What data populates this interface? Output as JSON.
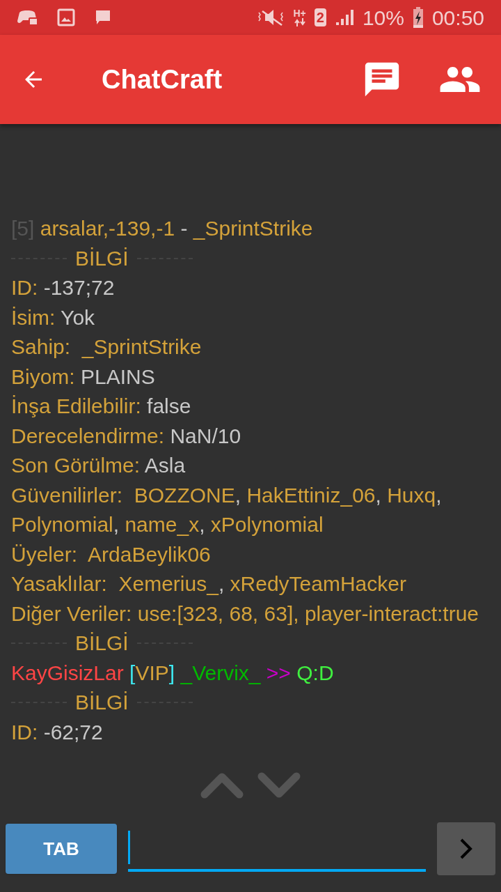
{
  "status_bar": {
    "sim_slot": "2",
    "network": "H+",
    "battery": "10%",
    "time": "00:50"
  },
  "app_bar": {
    "title": "ChatCraft"
  },
  "chat": [
    {
      "kind": "text",
      "segments": [
        {
          "text": "[5]",
          "color": "#555555"
        },
        {
          "text": " arsalar,-139,-1 ",
          "color": "#d4a23a"
        },
        {
          "text": "-",
          "color": "#c8c8c8"
        },
        {
          "text": " _SprintStrike",
          "color": "#d4a23a"
        }
      ]
    },
    {
      "kind": "divider",
      "text": "BİLGİ"
    },
    {
      "kind": "text",
      "segments": [
        {
          "text": "ID:",
          "color": "#d4a23a"
        },
        {
          "text": " -137;72",
          "color": "#c8c8c8"
        }
      ]
    },
    {
      "kind": "text",
      "segments": [
        {
          "text": "İsim:",
          "color": "#d4a23a"
        },
        {
          "text": " Yok",
          "color": "#c8c8c8"
        }
      ]
    },
    {
      "kind": "text",
      "segments": [
        {
          "text": "Sahip:  _SprintStrike",
          "color": "#d4a23a"
        }
      ]
    },
    {
      "kind": "text",
      "segments": [
        {
          "text": "Biyom:",
          "color": "#d4a23a"
        },
        {
          "text": " PLAINS",
          "color": "#c8c8c8"
        }
      ]
    },
    {
      "kind": "text",
      "segments": [
        {
          "text": "İnşa Edilebilir:",
          "color": "#d4a23a"
        },
        {
          "text": " false",
          "color": "#c8c8c8"
        }
      ]
    },
    {
      "kind": "text",
      "segments": [
        {
          "text": "Derecelendirme:",
          "color": "#d4a23a"
        },
        {
          "text": " NaN/10",
          "color": "#c8c8c8"
        }
      ]
    },
    {
      "kind": "text",
      "segments": [
        {
          "text": "Son Görülme:",
          "color": "#d4a23a"
        },
        {
          "text": " Asla",
          "color": "#c8c8c8"
        }
      ]
    },
    {
      "kind": "text",
      "segments": [
        {
          "text": "Güvenilirler:  BOZZONE",
          "color": "#d4a23a"
        },
        {
          "text": ", ",
          "color": "#c8c8c8"
        },
        {
          "text": "HakEttiniz_06",
          "color": "#d4a23a"
        },
        {
          "text": ", ",
          "color": "#c8c8c8"
        },
        {
          "text": "Huxq",
          "color": "#d4a23a"
        },
        {
          "text": ", ",
          "color": "#c8c8c8"
        },
        {
          "text": "Polynomial",
          "color": "#d4a23a"
        },
        {
          "text": ", ",
          "color": "#c8c8c8"
        },
        {
          "text": "name_x",
          "color": "#d4a23a"
        },
        {
          "text": ", ",
          "color": "#c8c8c8"
        },
        {
          "text": "xPolynomial",
          "color": "#d4a23a"
        }
      ]
    },
    {
      "kind": "text",
      "segments": [
        {
          "text": "Üyeler:  ArdaBeylik06",
          "color": "#d4a23a"
        }
      ]
    },
    {
      "kind": "text",
      "segments": [
        {
          "text": "Yasaklılar:  Xemerius_",
          "color": "#d4a23a"
        },
        {
          "text": ", ",
          "color": "#c8c8c8"
        },
        {
          "text": "xRedyTeamHacker",
          "color": "#d4a23a"
        }
      ]
    },
    {
      "kind": "text",
      "segments": [
        {
          "text": "Diğer Veriler: use:[323, 68, 63], player-interact:true",
          "color": "#d4a23a"
        }
      ]
    },
    {
      "kind": "divider",
      "text": "BİLGİ"
    },
    {
      "kind": "text",
      "segments": [
        {
          "text": "KayGisizLar ",
          "color": "#ff4545"
        },
        {
          "text": "[",
          "color": "#3ee8f0"
        },
        {
          "text": "VIP",
          "color": "#d4a23a"
        },
        {
          "text": "]",
          "color": "#3ee8f0"
        },
        {
          "text": " _Vervix_ ",
          "color": "#00b800"
        },
        {
          "text": ">> ",
          "color": "#c800c8"
        },
        {
          "text": "Q:D",
          "color": "#40f040"
        }
      ]
    },
    {
      "kind": "divider",
      "text": "BİLGİ"
    },
    {
      "kind": "text",
      "segments": [
        {
          "text": "ID:",
          "color": "#d4a23a"
        },
        {
          "text": " -62;72",
          "color": "#c8c8c8"
        }
      ]
    }
  ],
  "composer": {
    "tab_button": "TAB"
  }
}
